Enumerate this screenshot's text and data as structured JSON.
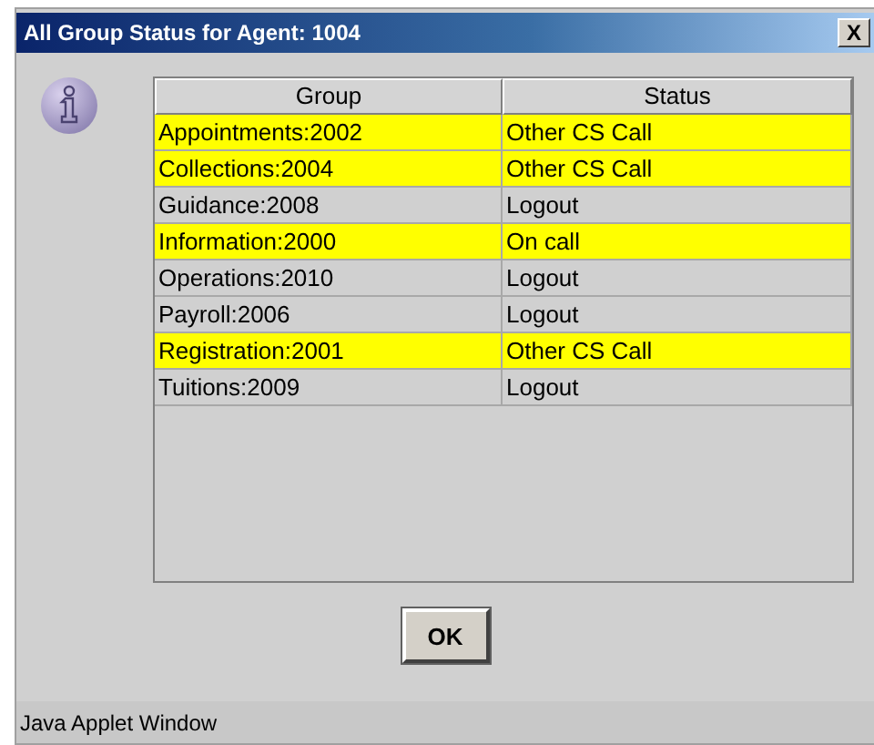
{
  "window": {
    "title": "All Group Status for Agent: 1004",
    "close_label": "X"
  },
  "table": {
    "columns": [
      "Group",
      "Status"
    ],
    "rows": [
      {
        "group": "Appointments:2002",
        "status": "Other CS Call",
        "highlighted": true
      },
      {
        "group": "Collections:2004",
        "status": "Other CS Call",
        "highlighted": true
      },
      {
        "group": "Guidance:2008",
        "status": "Logout",
        "highlighted": false
      },
      {
        "group": "Information:2000",
        "status": "On call",
        "highlighted": true
      },
      {
        "group": "Operations:2010",
        "status": "Logout",
        "highlighted": false
      },
      {
        "group": "Payroll:2006",
        "status": "Logout",
        "highlighted": false
      },
      {
        "group": "Registration:2001",
        "status": "Other CS Call",
        "highlighted": true
      },
      {
        "group": "Tuitions:2009",
        "status": "Logout",
        "highlighted": false
      }
    ]
  },
  "buttons": [
    "OK"
  ],
  "status_bar": "Java Applet Window"
}
